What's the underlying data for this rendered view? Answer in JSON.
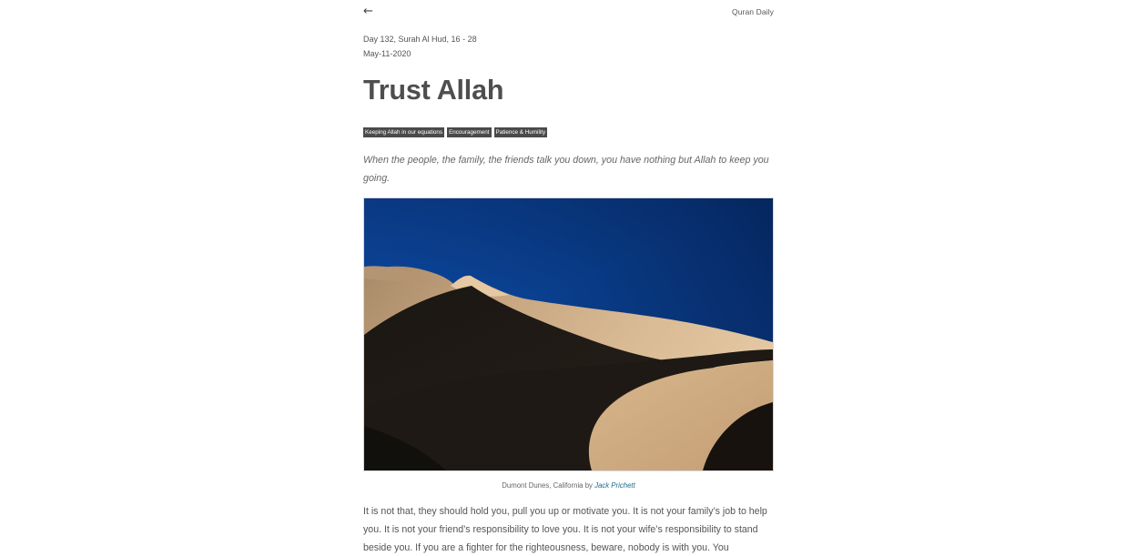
{
  "header": {
    "back_icon": "arrow-left-icon",
    "back_glyph": "←",
    "brand": "Quran Daily"
  },
  "article": {
    "day_line": "Day 132, Surah Al Hud, 16 - 28",
    "date": "May-11-2020",
    "title": "Trust Allah",
    "tags": [
      "Keeping Allah in our equations",
      "Encouragement",
      "Patience & Humility"
    ],
    "summary": "When the people, the family, the friends talk you down, you have nothing but Allah to keep you going.",
    "image": {
      "caption_text": "Dumont Dunes, California by",
      "caption_author": "Jack Prichett"
    },
    "body": "It is not that, they should hold you, pull you up or motivate you. It is not your family’s job to help you. It is not your friend’s responsibility to love you. It is not your wife’s responsibility to stand beside you. If you are a fighter for the righteousness, beware, nobody is with you. You"
  },
  "colors": {
    "tag_background": "#4a4a4a",
    "link": "#1d6a8f",
    "sky_top": "#0b2f6b",
    "sky_mid": "#0a4a9e"
  }
}
